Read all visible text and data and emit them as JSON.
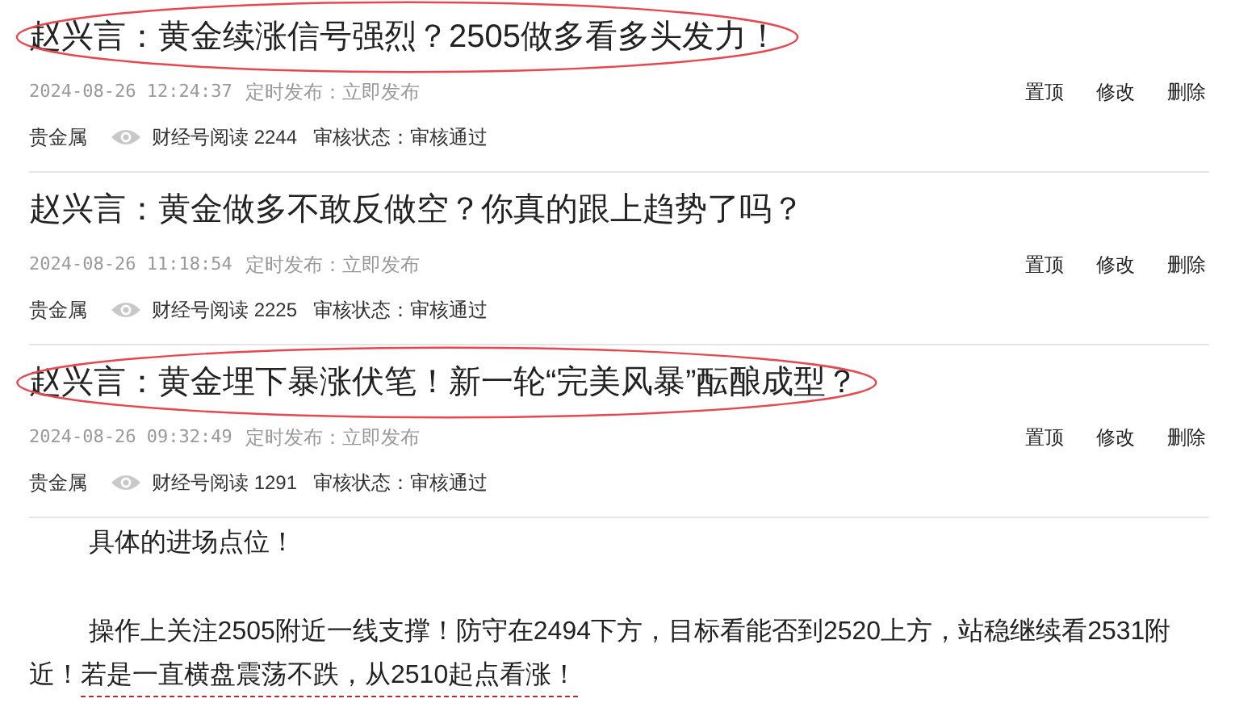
{
  "articles": [
    {
      "title": "赵兴言：黄金续涨信号强烈？2505做多看多头发力！",
      "circled": true,
      "date": "2024-08-26 12:24:37",
      "schedule": "定时发布：立即发布",
      "actions": [
        "置顶",
        "修改",
        "删除"
      ],
      "category": "贵金属",
      "reads": "财经号阅读 2244",
      "review": "审核状态：审核通过"
    },
    {
      "title": "赵兴言：黄金做多不敢反做空？你真的跟上趋势了吗？",
      "circled": false,
      "date": "2024-08-26 11:18:54",
      "schedule": "定时发布：立即发布",
      "actions": [
        "置顶",
        "修改",
        "删除"
      ],
      "category": "贵金属",
      "reads": "财经号阅读 2225",
      "review": "审核状态：审核通过"
    },
    {
      "title": "赵兴言：黄金埋下暴涨伏笔！新一轮“完美风暴”酝酿成型？",
      "circled": true,
      "date": "2024-08-26 09:32:49",
      "schedule": "定时发布：立即发布",
      "actions": [
        "置顶",
        "修改",
        "删除"
      ],
      "category": "贵金属",
      "reads": "财经号阅读 1291",
      "review": "审核状态：审核通过"
    }
  ],
  "body": [
    {
      "segments": [
        {
          "text": "具体的进场点位！",
          "underlined": false
        }
      ]
    },
    {
      "segments": [
        {
          "text": "操作上关注2505附近一线支撑！防守在2494下方，目标看能否到2520上方，站稳继续看2531附近！",
          "underlined": false
        },
        {
          "text": "若是一直横盘震荡不跌，从2510起点看涨！",
          "underlined": true
        }
      ]
    }
  ]
}
